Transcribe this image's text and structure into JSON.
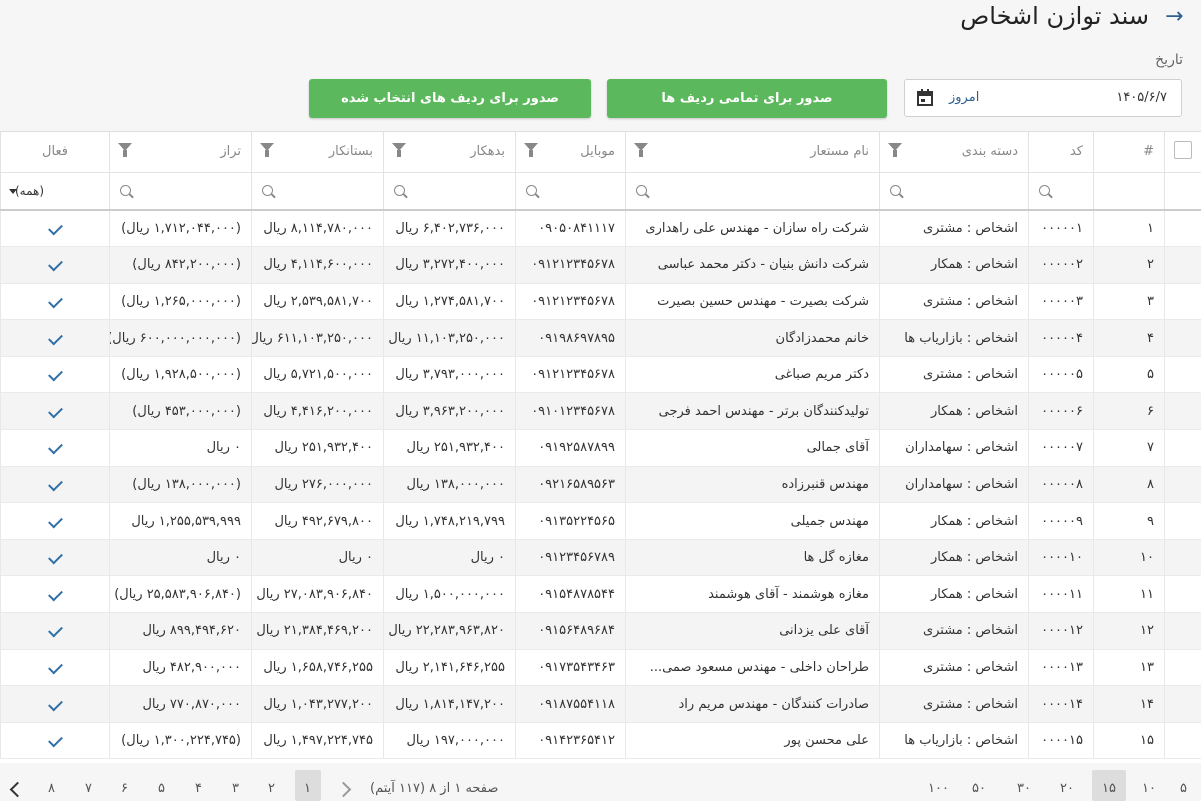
{
  "header": {
    "title": "سند توازن اشخاص",
    "back_icon": "arrow-right-icon"
  },
  "date": {
    "label": "تاریخ",
    "value": "۱۴۰۵/۶/۷",
    "today": "امروز",
    "icon": "calendar-icon"
  },
  "buttons": {
    "issue_all": "صدور برای تمامی ردیف ها",
    "issue_selected": "صدور برای ردیف های انتخاب شده",
    "color": "#5cb85c"
  },
  "columns": {
    "index": "#",
    "code": "کد",
    "category": "دسته بندی",
    "name": "نام مستعار",
    "mobile": "موبایل",
    "debit": "بدهکار",
    "credit": "بستانکار",
    "balance": "تراز",
    "active": "فعال"
  },
  "filters": {
    "active_all": "(همه)"
  },
  "rows": [
    {
      "index": "۱",
      "code": "۰۰۰۰۰۱",
      "category": "اشخاص : مشتری",
      "name": "شرکت راه سازان - مهندس علی راهداری",
      "mobile": "۰۹۰۵۰۸۴۱۱۱۷",
      "debit": "۶,۴۰۲,۷۳۶,۰۰۰ ریال",
      "credit": "۸,۱۱۴,۷۸۰,۰۰۰ ریال",
      "balance": "(۱,۷۱۲,۰۴۴,۰۰۰ ریال)",
      "neg": true
    },
    {
      "index": "۲",
      "code": "۰۰۰۰۰۲",
      "category": "اشخاص : همکار",
      "name": "شرکت دانش بنیان - دکتر محمد عباسی",
      "mobile": "۰۹۱۲۱۲۳۴۵۶۷۸",
      "debit": "۳,۲۷۲,۴۰۰,۰۰۰ ریال",
      "credit": "۴,۱۱۴,۶۰۰,۰۰۰ ریال",
      "balance": "(۸۴۲,۲۰۰,۰۰۰ ریال)",
      "neg": true
    },
    {
      "index": "۳",
      "code": "۰۰۰۰۰۳",
      "category": "اشخاص : مشتری",
      "name": "شرکت بصیرت - مهندس حسین بصیرت",
      "mobile": "۰۹۱۲۱۲۳۴۵۶۷۸",
      "debit": "۱,۲۷۴,۵۸۱,۷۰۰ ریال",
      "credit": "۲,۵۳۹,۵۸۱,۷۰۰ ریال",
      "balance": "(۱,۲۶۵,۰۰۰,۰۰۰ ریال)",
      "neg": true
    },
    {
      "index": "۴",
      "code": "۰۰۰۰۰۴",
      "category": "اشخاص : بازاریاب ها",
      "name": "خانم محمدزادگان",
      "mobile": "۰۹۱۹۸۶۹۷۸۹۵",
      "debit": "۱۱,۱۰۳,۲۵۰,۰۰۰ ریال",
      "credit": "۶۱۱,۱۰۳,۲۵۰,۰۰۰ ریال",
      "balance": "(۶۰۰,۰۰۰,۰۰۰,۰۰۰ ریال)",
      "neg": true
    },
    {
      "index": "۵",
      "code": "۰۰۰۰۰۵",
      "category": "اشخاص : مشتری",
      "name": "دکتر مریم صباغی",
      "mobile": "۰۹۱۲۱۲۳۴۵۶۷۸",
      "debit": "۳,۷۹۳,۰۰۰,۰۰۰ ریال",
      "credit": "۵,۷۲۱,۵۰۰,۰۰۰ ریال",
      "balance": "(۱,۹۲۸,۵۰۰,۰۰۰ ریال)",
      "neg": true
    },
    {
      "index": "۶",
      "code": "۰۰۰۰۰۶",
      "category": "اشخاص : همکار",
      "name": "تولیدکنندگان برتر - مهندس احمد فرجی",
      "mobile": "۰۹۱۰۱۲۳۴۵۶۷۸",
      "debit": "۳,۹۶۳,۲۰۰,۰۰۰ ریال",
      "credit": "۴,۴۱۶,۲۰۰,۰۰۰ ریال",
      "balance": "(۴۵۳,۰۰۰,۰۰۰ ریال)",
      "neg": true
    },
    {
      "index": "۷",
      "code": "۰۰۰۰۰۷",
      "category": "اشخاص : سهامداران",
      "name": "آقای جمالی",
      "mobile": "۰۹۱۹۲۵۸۷۸۹۹",
      "debit": "۲۵۱,۹۳۲,۴۰۰ ریال",
      "credit": "۲۵۱,۹۳۲,۴۰۰ ریال",
      "balance": "۰ ریال",
      "neg": false
    },
    {
      "index": "۸",
      "code": "۰۰۰۰۰۸",
      "category": "اشخاص : سهامداران",
      "name": "مهندس قنبرزاده",
      "mobile": "۰۹۲۱۶۵۸۹۵۶۳",
      "debit": "۱۳۸,۰۰۰,۰۰۰ ریال",
      "credit": "۲۷۶,۰۰۰,۰۰۰ ریال",
      "balance": "(۱۳۸,۰۰۰,۰۰۰ ریال)",
      "neg": true
    },
    {
      "index": "۹",
      "code": "۰۰۰۰۰۹",
      "category": "اشخاص : همکار",
      "name": "مهندس جمیلی",
      "mobile": "۰۹۱۳۵۲۲۴۵۶۵",
      "debit": "۱,۷۴۸,۲۱۹,۷۹۹ ریال",
      "credit": "۴۹۲,۶۷۹,۸۰۰ ریال",
      "balance": "۱,۲۵۵,۵۳۹,۹۹۹ ریال",
      "neg": false
    },
    {
      "index": "۱۰",
      "code": "۰۰۰۰۱۰",
      "category": "اشخاص : همکار",
      "name": "مغازه گل ها",
      "mobile": "۰۹۱۲۳۴۵۶۷۸۹",
      "debit": "۰ ریال",
      "credit": "۰ ریال",
      "balance": "۰ ریال",
      "neg": false
    },
    {
      "index": "۱۱",
      "code": "۰۰۰۰۱۱",
      "category": "اشخاص : همکار",
      "name": "مغازه هوشمند - آقای هوشمند",
      "mobile": "۰۹۱۵۴۸۷۸۵۴۴",
      "debit": "۱,۵۰۰,۰۰۰,۰۰۰ ریال",
      "credit": "۲۷,۰۸۳,۹۰۶,۸۴۰ ریال",
      "balance": "(۲۵,۵۸۳,۹۰۶,۸۴۰ ریال)",
      "neg": true
    },
    {
      "index": "۱۲",
      "code": "۰۰۰۰۱۲",
      "category": "اشخاص : مشتری",
      "name": "آقای علی یزدانی",
      "mobile": "۰۹۱۵۶۴۸۹۶۸۴",
      "debit": "۲۲,۲۸۳,۹۶۳,۸۲۰ ریال",
      "credit": "۲۱,۳۸۴,۴۶۹,۲۰۰ ریال",
      "balance": "۸۹۹,۴۹۴,۶۲۰ ریال",
      "neg": false
    },
    {
      "index": "۱۳",
      "code": "۰۰۰۰۱۳",
      "category": "اشخاص : مشتری",
      "name": "طراحان داخلی - مهندس مسعود صمی...",
      "mobile": "۰۹۱۷۳۵۴۳۴۶۳",
      "debit": "۲,۱۴۱,۶۴۶,۲۵۵ ریال",
      "credit": "۱,۶۵۸,۷۴۶,۲۵۵ ریال",
      "balance": "۴۸۲,۹۰۰,۰۰۰ ریال",
      "neg": false
    },
    {
      "index": "۱۴",
      "code": "۰۰۰۰۱۴",
      "category": "اشخاص : مشتری",
      "name": "صادرات کنندگان - مهندس مریم راد",
      "mobile": "۰۹۱۸۷۵۵۴۱۱۸",
      "debit": "۱,۸۱۴,۱۴۷,۲۰۰ ریال",
      "credit": "۱,۰۴۳,۲۷۷,۲۰۰ ریال",
      "balance": "۷۷۰,۸۷۰,۰۰۰ ریال",
      "neg": false
    },
    {
      "index": "۱۵",
      "code": "۰۰۰۰۱۵",
      "category": "اشخاص : بازاریاب ها",
      "name": "علی محسن پور",
      "mobile": "۰۹۱۴۲۳۶۵۴۱۲",
      "debit": "۱۹۷,۰۰۰,۰۰۰ ریال",
      "credit": "۱,۴۹۷,۲۲۴,۷۴۵ ریال",
      "balance": "(۱,۳۰۰,۲۲۴,۷۴۵ ریال)",
      "neg": true
    }
  ],
  "pager": {
    "page_sizes": [
      "۵",
      "۱۰",
      "۱۵",
      "۲۰",
      "۳۰",
      "۵۰",
      "۱۰۰"
    ],
    "page_info": "صفحه ۱ از ۸ (۱۱۷ آیتم)",
    "pages": [
      "۱",
      "۲",
      "۳",
      "۴",
      "۵",
      "۶",
      "۷",
      "۸"
    ]
  }
}
